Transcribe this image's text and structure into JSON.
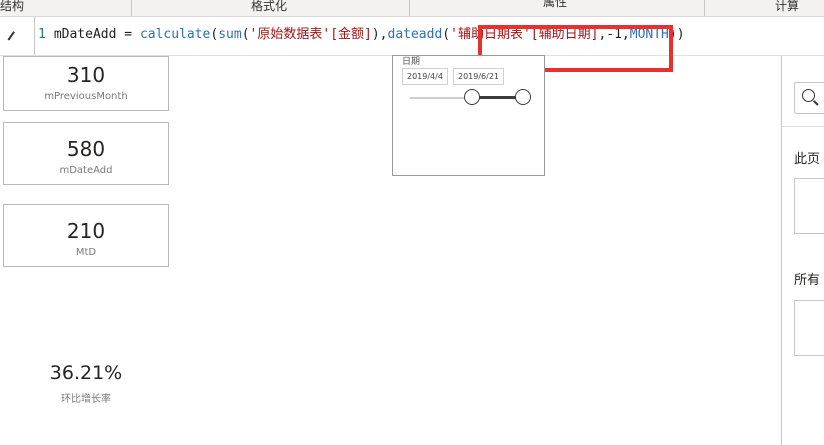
{
  "ribbon": {
    "tabs": [
      {
        "label": "结构"
      },
      {
        "label": "格式化"
      },
      {
        "label": "属性"
      },
      {
        "label": "计算"
      }
    ]
  },
  "formula_bar": {
    "line_number": "1",
    "tokens": {
      "measure_name": "mDateAdd",
      "equals": " = ",
      "fn_calculate": "calculate",
      "p1": "(",
      "fn_sum": "sum",
      "p2": "(",
      "str_table": "'原始数据表'",
      "col_amount": "[金额]",
      "p3": "),",
      "fn_dateadd": "dateadd",
      "p4": "(",
      "str_table2": "'辅助日期表'",
      "col_date": "[辅助日期]",
      "args": ",-1,",
      "kw_month": "MONTH",
      "p5": "))"
    }
  },
  "cards": [
    {
      "value": "310",
      "label": "mPreviousMonth"
    },
    {
      "value": "580",
      "label": "mDateAdd"
    },
    {
      "value": "210",
      "label": "MtD"
    }
  ],
  "kpi": {
    "value": "36.21%",
    "label": "环比增长率"
  },
  "slicer": {
    "title": "日期",
    "start_date": "2019/4/4",
    "end_date": "2019/6/21"
  },
  "right_pane": {
    "search_icon": "search-icon",
    "label_this_page": "此页",
    "label_all_pages": "所有"
  },
  "colors": {
    "highlight": "#e8312f",
    "function": "#2e6fb7",
    "string": "#a31515"
  }
}
